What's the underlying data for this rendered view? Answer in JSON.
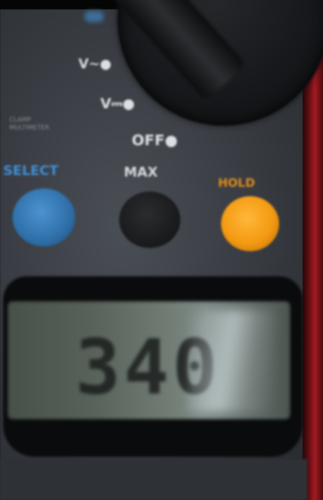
{
  "dial": {
    "v_ac_label": "V~●",
    "v_dc_label": "V⎓●",
    "off_label": "OFF●",
    "small_text": [
      "CLAMP",
      "MULTIMETER"
    ]
  },
  "buttons": {
    "select_label": "SELECT",
    "max_label": "MAX",
    "hold_label": "HOLD"
  },
  "display": {
    "reading": "340"
  },
  "colors": {
    "select": "#3f8fd8",
    "hold": "#f49a12",
    "body": "#3a3e44",
    "accent_red": "#a31a22"
  }
}
